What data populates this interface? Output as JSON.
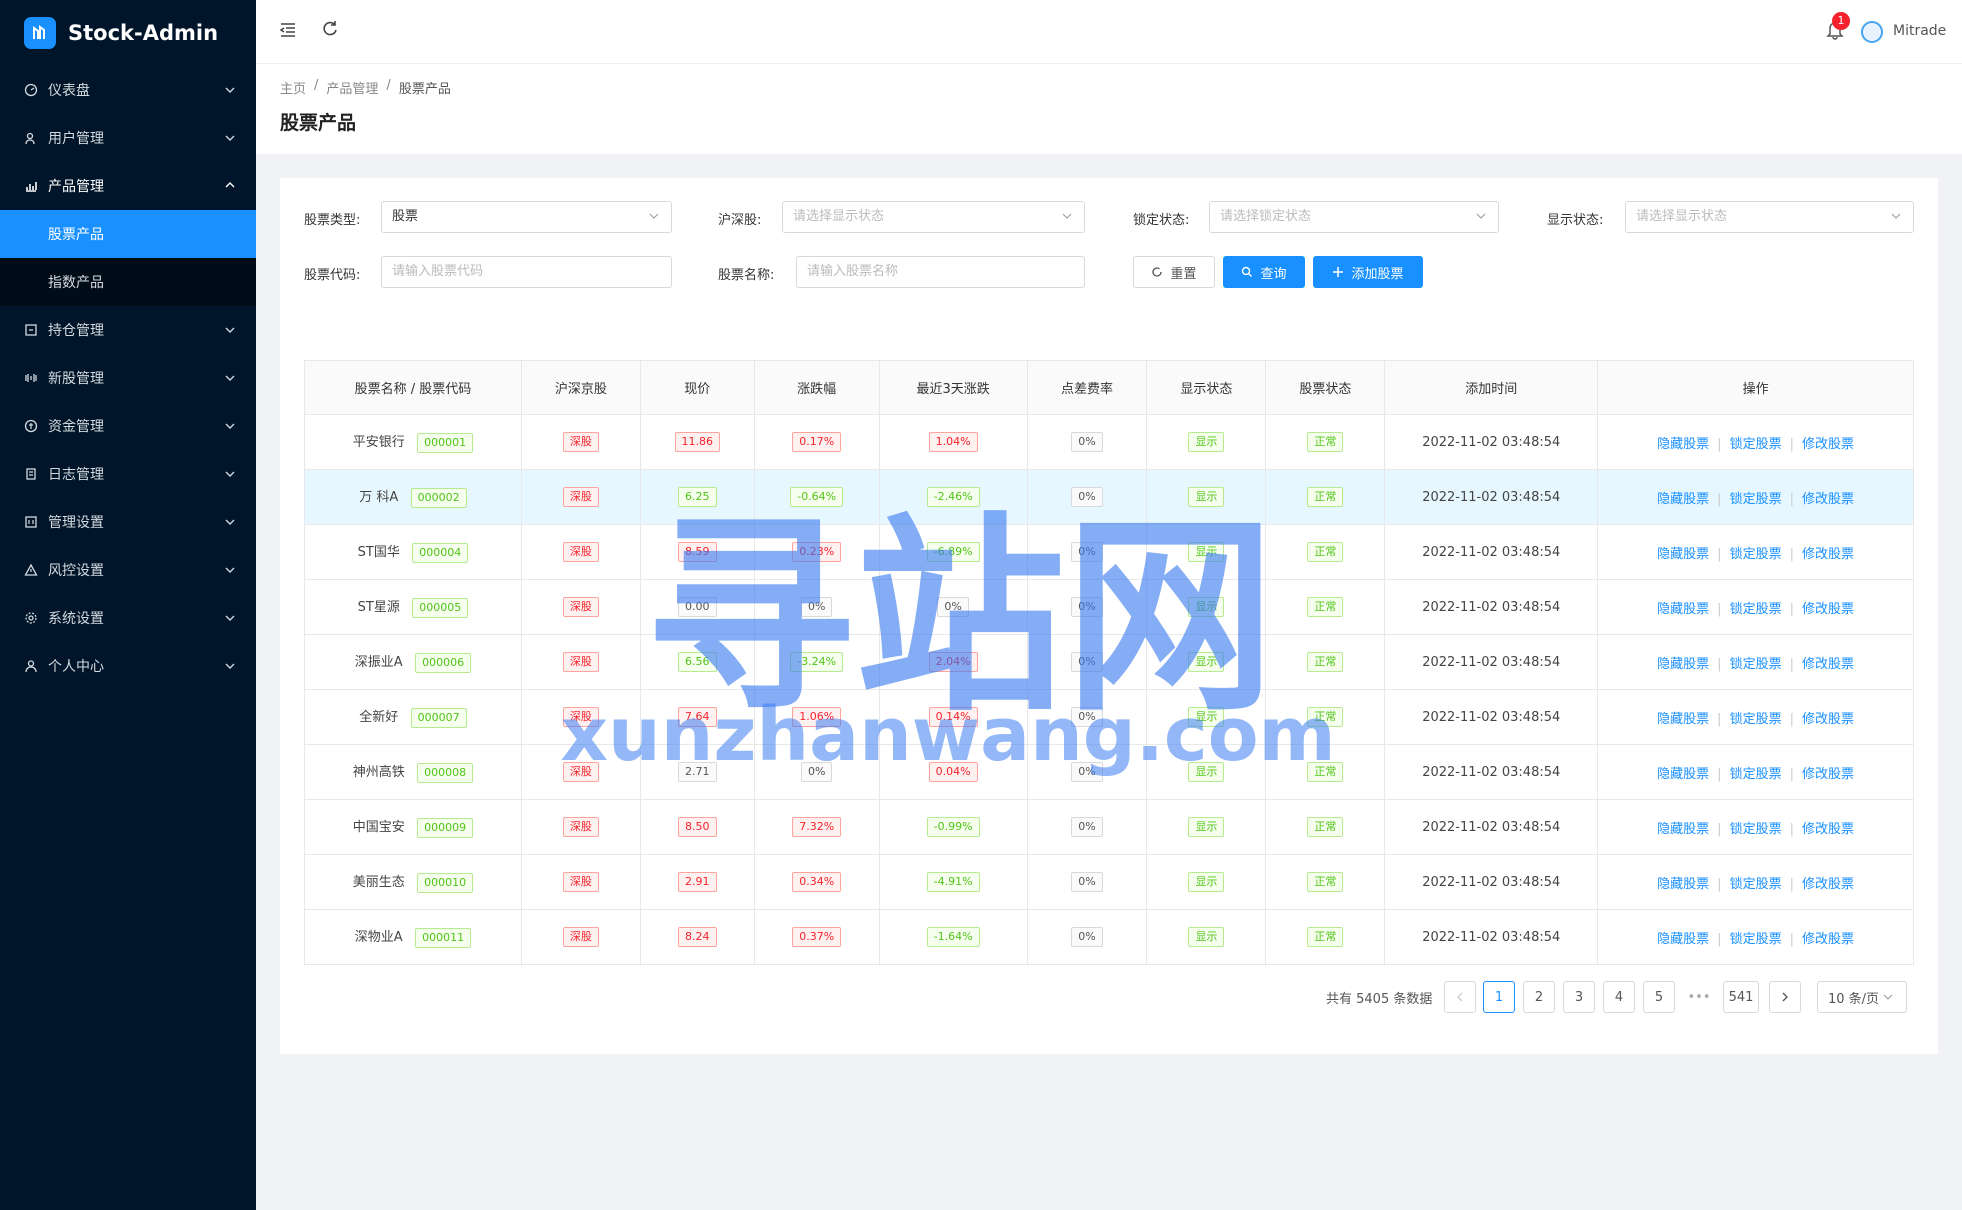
{
  "app": {
    "title": "Stock-Admin"
  },
  "sidebar": {
    "items": [
      {
        "label": "仪表盘",
        "icon": "dashboard-icon"
      },
      {
        "label": "用户管理",
        "icon": "user-icon"
      },
      {
        "label": "产品管理",
        "icon": "chart-icon",
        "open": true,
        "children": [
          {
            "label": "股票产品",
            "active": true
          },
          {
            "label": "指数产品"
          }
        ]
      },
      {
        "label": "持仓管理",
        "icon": "position-icon"
      },
      {
        "label": "新股管理",
        "icon": "new-stock-icon"
      },
      {
        "label": "资金管理",
        "icon": "money-icon"
      },
      {
        "label": "日志管理",
        "icon": "log-icon"
      },
      {
        "label": "管理设置",
        "icon": "admin-settings-icon"
      },
      {
        "label": "风控设置",
        "icon": "warning-icon"
      },
      {
        "label": "系统设置",
        "icon": "gear-icon"
      },
      {
        "label": "个人中心",
        "icon": "person-icon"
      }
    ]
  },
  "header": {
    "notification_count": "1",
    "username": "Mitrade"
  },
  "breadcrumb": [
    "主页",
    "产品管理",
    "股票产品"
  ],
  "page_title": "股票产品",
  "filters": {
    "stock_type": {
      "label": "股票类型:",
      "value": "股票"
    },
    "market": {
      "label": "沪深股:",
      "placeholder": "请选择显示状态"
    },
    "lock_status": {
      "label": "锁定状态:",
      "placeholder": "请选择锁定状态"
    },
    "display_status": {
      "label": "显示状态:",
      "placeholder": "请选择显示状态"
    },
    "stock_code": {
      "label": "股票代码:",
      "placeholder": "请输入股票代码"
    },
    "stock_name": {
      "label": "股票名称:",
      "placeholder": "请输入股票名称"
    }
  },
  "buttons": {
    "reset": "重置",
    "search": "查询",
    "add": "添加股票"
  },
  "table": {
    "headers": [
      "股票名称 / 股票代码",
      "沪深京股",
      "现价",
      "涨跌幅",
      "最近3天涨跌",
      "点差费率",
      "显示状态",
      "股票状态",
      "添加时间",
      "操作"
    ],
    "actions": [
      "隐藏股票",
      "锁定股票",
      "修改股票"
    ],
    "rows": [
      {
        "name": "平安银行",
        "code": "000001",
        "market": "深股",
        "price": "11.86",
        "price_color": "red",
        "change": "0.17%",
        "change_color": "red",
        "change3": "1.04%",
        "change3_color": "red",
        "fee": "0%",
        "display": "显示",
        "status": "正常",
        "time": "2022-11-02 03:48:54"
      },
      {
        "name": "万 科A",
        "code": "000002",
        "market": "深股",
        "price": "6.25",
        "price_color": "green",
        "change": "-0.64%",
        "change_color": "green",
        "change3": "-2.46%",
        "change3_color": "green",
        "fee": "0%",
        "display": "显示",
        "status": "正常",
        "time": "2022-11-02 03:48:54"
      },
      {
        "name": "ST国华",
        "code": "000004",
        "market": "深股",
        "price": "8.59",
        "price_color": "red",
        "change": "0.23%",
        "change_color": "red",
        "change3": "-6.89%",
        "change3_color": "green",
        "fee": "0%",
        "display": "显示",
        "status": "正常",
        "time": "2022-11-02 03:48:54"
      },
      {
        "name": "ST星源",
        "code": "000005",
        "market": "深股",
        "price": "0.00",
        "price_color": "neutral",
        "change": "0%",
        "change_color": "neutral",
        "change3": "0%",
        "change3_color": "neutral",
        "fee": "0%",
        "display": "显示",
        "status": "正常",
        "time": "2022-11-02 03:48:54"
      },
      {
        "name": "深振业A",
        "code": "000006",
        "market": "深股",
        "price": "6.56",
        "price_color": "green",
        "change": "-3.24%",
        "change_color": "green",
        "change3": "2.04%",
        "change3_color": "red",
        "fee": "0%",
        "display": "显示",
        "status": "正常",
        "time": "2022-11-02 03:48:54"
      },
      {
        "name": "全新好",
        "code": "000007",
        "market": "深股",
        "price": "7.64",
        "price_color": "red",
        "change": "1.06%",
        "change_color": "red",
        "change3": "0.14%",
        "change3_color": "red",
        "fee": "0%",
        "display": "显示",
        "status": "正常",
        "time": "2022-11-02 03:48:54"
      },
      {
        "name": "神州高铁",
        "code": "000008",
        "market": "深股",
        "price": "2.71",
        "price_color": "neutral",
        "change": "0%",
        "change_color": "neutral",
        "change3": "0.04%",
        "change3_color": "red",
        "fee": "0%",
        "display": "显示",
        "status": "正常",
        "time": "2022-11-02 03:48:54"
      },
      {
        "name": "中国宝安",
        "code": "000009",
        "market": "深股",
        "price": "8.50",
        "price_color": "red",
        "change": "7.32%",
        "change_color": "red",
        "change3": "-0.99%",
        "change3_color": "green",
        "fee": "0%",
        "display": "显示",
        "status": "正常",
        "time": "2022-11-02 03:48:54"
      },
      {
        "name": "美丽生态",
        "code": "000010",
        "market": "深股",
        "price": "2.91",
        "price_color": "red",
        "change": "0.34%",
        "change_color": "red",
        "change3": "-4.91%",
        "change3_color": "green",
        "fee": "0%",
        "display": "显示",
        "status": "正常",
        "time": "2022-11-02 03:48:54"
      },
      {
        "name": "深物业A",
        "code": "000011",
        "market": "深股",
        "price": "8.24",
        "price_color": "red",
        "change": "0.37%",
        "change_color": "red",
        "change3": "-1.64%",
        "change3_color": "green",
        "fee": "0%",
        "display": "显示",
        "status": "正常",
        "time": "2022-11-02 03:48:54"
      }
    ]
  },
  "pagination": {
    "total_text": "共有 5405 条数据",
    "pages": [
      "1",
      "2",
      "3",
      "4",
      "5"
    ],
    "ellipsis": "•••",
    "last_page": "541",
    "current": "1",
    "page_size": "10 条/页"
  },
  "watermark": {
    "text_cn": "寻站网",
    "text_en": "xunzhanwang.com"
  },
  "colors": {
    "primary": "#1890ff",
    "sidebar": "#001529",
    "red": "#f5222d",
    "green": "#52c41a"
  }
}
